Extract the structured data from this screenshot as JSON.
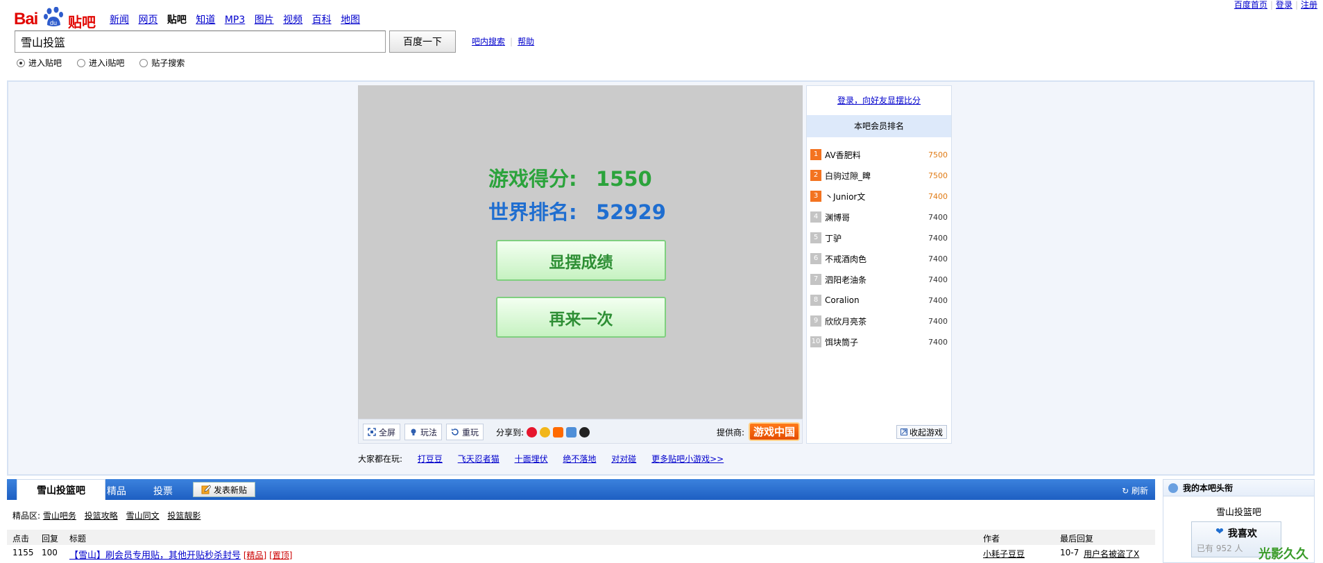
{
  "top_links": {
    "home": "百度首页",
    "login": "登录",
    "register": "注册"
  },
  "logo": {
    "bai": "Bai",
    "du": "du",
    "tieba": "贴吧"
  },
  "nav": [
    "新闻",
    "网页",
    "贴吧",
    "知道",
    "MP3",
    "图片",
    "视频",
    "百科",
    "地图"
  ],
  "nav_current": "贴吧",
  "search": {
    "value": "雪山投篮",
    "button": "百度一下",
    "in_bar_search": "吧内搜索",
    "help": "帮助"
  },
  "radios": [
    {
      "label": "进入贴吧",
      "checked": true
    },
    {
      "label": "进入i贴吧",
      "checked": false
    },
    {
      "label": "贴子搜索",
      "checked": false
    }
  ],
  "game": {
    "score_label": "游戏得分:",
    "score_value": "1550",
    "rank_label": "世界排名:",
    "rank_value": "52929",
    "show_button": "显摆成绩",
    "again_button": "再来一次",
    "toolbar": {
      "fullscreen": "全屏",
      "howto": "玩法",
      "replay": "重玩",
      "share": "分享到:",
      "provider": "提供商:",
      "provider_logo": "游戏中国"
    },
    "playing_label": "大家都在玩:",
    "playing": [
      "打豆豆",
      "飞天忍者猫",
      "十面埋伏",
      "绝不落地",
      "对对碰",
      "更多贴吧小游戏>>"
    ]
  },
  "ranking": {
    "login_prompt": "登录，向好友显摆比分",
    "header": "本吧会员排名",
    "rows": [
      {
        "no": "1",
        "name": "AV香肥料",
        "score": "7500"
      },
      {
        "no": "2",
        "name": "白驹过隙_睥",
        "score": "7500"
      },
      {
        "no": "3",
        "name": "丶Junior文",
        "score": "7400"
      },
      {
        "no": "4",
        "name": "渊博哥",
        "score": "7400"
      },
      {
        "no": "5",
        "name": "丁驴",
        "score": "7400"
      },
      {
        "no": "6",
        "name": "不戒酒肉色",
        "score": "7400"
      },
      {
        "no": "7",
        "name": "泗阳老油条",
        "score": "7400"
      },
      {
        "no": "8",
        "name": "Coralion",
        "score": "7400"
      },
      {
        "no": "9",
        "name": "欣欣月亮茶",
        "score": "7400"
      },
      {
        "no": "10",
        "name": "饵块筒子",
        "score": "7400"
      }
    ],
    "fold": "收起游戏"
  },
  "forum": {
    "active_tab": "雪山投篮吧",
    "tabs": [
      "精品",
      "投票"
    ],
    "post_button": "发表新贴",
    "refresh": "刷新",
    "good_label": "精品区:",
    "good_links": [
      "雪山吧务",
      "投篮攻略",
      "雪山同文",
      "投篮靓影"
    ],
    "columns": {
      "clicks": "点击",
      "replies": "回复",
      "title": "标题",
      "author": "作者",
      "last": "最后回复"
    },
    "threads": [
      {
        "clicks": "1155",
        "replies": "100",
        "title": "【雪山】刷会员专用贴，其他开贴秒杀封号",
        "tags": [
          "精品",
          "置顶"
        ],
        "author": "小耗子豆豆",
        "last_time": "10-7",
        "last_user": "用户名被盗了X"
      }
    ]
  },
  "my_box": {
    "title": "我的本吧头衔",
    "bar_name": "雪山投篮吧",
    "like_button": "我喜欢",
    "like_count": "已有 952 人",
    "watermark": "光影久久"
  },
  "colors": {
    "brand_red": "#e10601",
    "link_blue": "#0000cc",
    "score_green": "#2ba33b",
    "rank_blue": "#1f6ed0",
    "forum_blue": "#1e5fc2"
  }
}
